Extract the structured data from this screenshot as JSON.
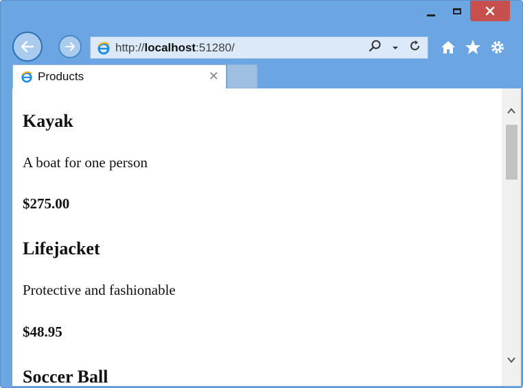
{
  "window": {
    "controls": {
      "minimize": "minimize",
      "maximize": "maximize",
      "close": "close"
    }
  },
  "toolbar": {
    "url_prefix": "http://",
    "url_host": "localhost",
    "url_suffix": ":51280/"
  },
  "tabs": [
    {
      "label": "Products",
      "active": true
    }
  ],
  "products": [
    {
      "name": "Kayak",
      "description": "A boat for one person",
      "price": "$275.00"
    },
    {
      "name": "Lifejacket",
      "description": "Protective and fashionable",
      "price": "$48.95"
    },
    {
      "name": "Soccer Ball"
    }
  ],
  "colors": {
    "frame": "#6ca6e2",
    "close_button": "#c7504f",
    "address_bar": "#dbe9f9"
  }
}
